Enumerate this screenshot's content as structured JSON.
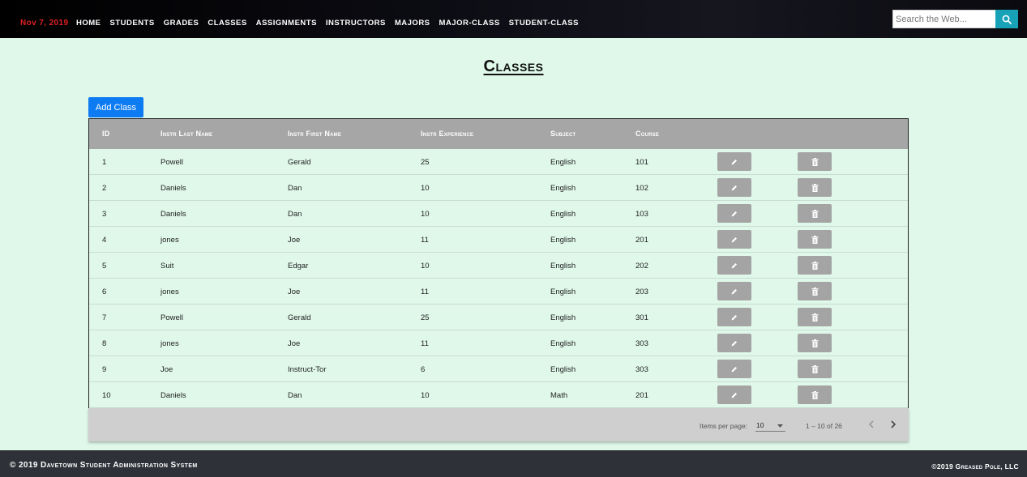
{
  "nav": {
    "date": "Nov 7, 2019",
    "links": [
      "HOME",
      "STUDENTS",
      "GRADES",
      "CLASSES",
      "ASSIGNMENTS",
      "INSTRUCTORS",
      "MAJORS",
      "MAJOR-CLASS",
      "STUDENT-CLASS"
    ],
    "search_placeholder": "Search the Web...",
    "search_icon": "search-icon"
  },
  "page": {
    "title": "Classes",
    "add_button_label": "Add Class"
  },
  "table": {
    "headers": [
      "ID",
      "Instr Last Name",
      "Instr First Name",
      "Instr Experience",
      "Subject",
      "Course"
    ],
    "rows": [
      [
        "1",
        "Powell",
        "Gerald",
        "25",
        "English",
        "101"
      ],
      [
        "2",
        "Daniels",
        "Dan",
        "10",
        "English",
        "102"
      ],
      [
        "3",
        "Daniels",
        "Dan",
        "10",
        "English",
        "103"
      ],
      [
        "4",
        "jones",
        "Joe",
        "11",
        "English",
        "201"
      ],
      [
        "5",
        "Suit",
        "Edgar",
        "10",
        "English",
        "202"
      ],
      [
        "6",
        "jones",
        "Joe",
        "11",
        "English",
        "203"
      ],
      [
        "7",
        "Powell",
        "Gerald",
        "25",
        "English",
        "301"
      ],
      [
        "8",
        "jones",
        "Joe",
        "11",
        "English",
        "303"
      ],
      [
        "9",
        "Joe",
        "Instruct-Tor",
        "6",
        "English",
        "303"
      ],
      [
        "10",
        "Daniels",
        "Dan",
        "10",
        "Math",
        "201"
      ]
    ],
    "row_actions": [
      "edit-icon",
      "delete-icon"
    ]
  },
  "paginator": {
    "items_per_page_label": "Items per page:",
    "items_per_page_value": "10",
    "range_label": "1 – 10 of 26"
  },
  "footer": {
    "left": "© 2019 Davetown Student Administration System",
    "right": "©2019 Greased Pole, LLC"
  },
  "colors": {
    "accent": "#0d7bf2",
    "search_button": "#17a2b8",
    "date": "#e02020",
    "page_bg": "#dff8ea",
    "header_bg": "#a6a6a6",
    "footer_bg": "#2e3138"
  }
}
